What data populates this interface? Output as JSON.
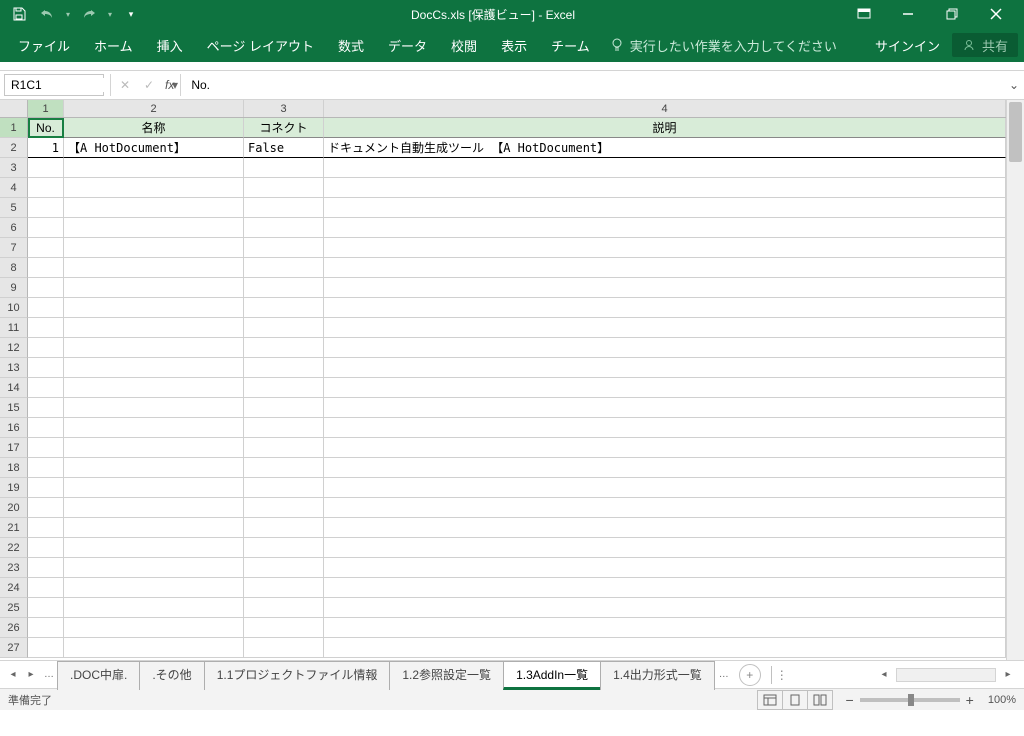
{
  "title": "DocCs.xls  [保護ビュー] - Excel",
  "qat": {
    "save": "save",
    "undo": "undo",
    "redo": "redo"
  },
  "win": {
    "ribbon_opts": "▾",
    "restore_sm": "❐",
    "min": "—",
    "restore": "❐",
    "close": "✕"
  },
  "tabs": [
    "ファイル",
    "ホーム",
    "挿入",
    "ページ レイアウト",
    "数式",
    "データ",
    "校閲",
    "表示",
    "チーム"
  ],
  "tellme": "実行したい作業を入力してください",
  "signin": "サインイン",
  "share": "共有",
  "nameBox": "R1C1",
  "formula": "No.",
  "colHeaders": [
    "1",
    "2",
    "3",
    "4"
  ],
  "rowHeaders": [
    "1",
    "2",
    "3",
    "4",
    "5",
    "6",
    "7",
    "8",
    "9",
    "10",
    "11",
    "12",
    "13",
    "14",
    "15",
    "16",
    "17",
    "18",
    "19",
    "20",
    "21",
    "22",
    "23",
    "24",
    "25",
    "26",
    "27"
  ],
  "headerRow": {
    "c1": "No.",
    "c2": "名称",
    "c3": "コネクト",
    "c4": "説明"
  },
  "dataRow": {
    "c1": "1",
    "c2": "【A HotDocument】",
    "c3": "False",
    "c4": "ドキュメント自動生成ツール 【A HotDocument】"
  },
  "sheetNav": {
    "ellipsis": "…"
  },
  "sheets": [
    {
      "label": ".DOC中扉.",
      "active": false
    },
    {
      "label": ".その他",
      "active": false
    },
    {
      "label": "1.1プロジェクトファイル情報",
      "active": false
    },
    {
      "label": "1.2参照設定一覧",
      "active": false
    },
    {
      "label": "1.3AddIn一覧",
      "active": true
    },
    {
      "label": "1.4出力形式一覧",
      "active": false
    }
  ],
  "sheetMore": "…",
  "status": "準備完了",
  "zoom": "100%"
}
